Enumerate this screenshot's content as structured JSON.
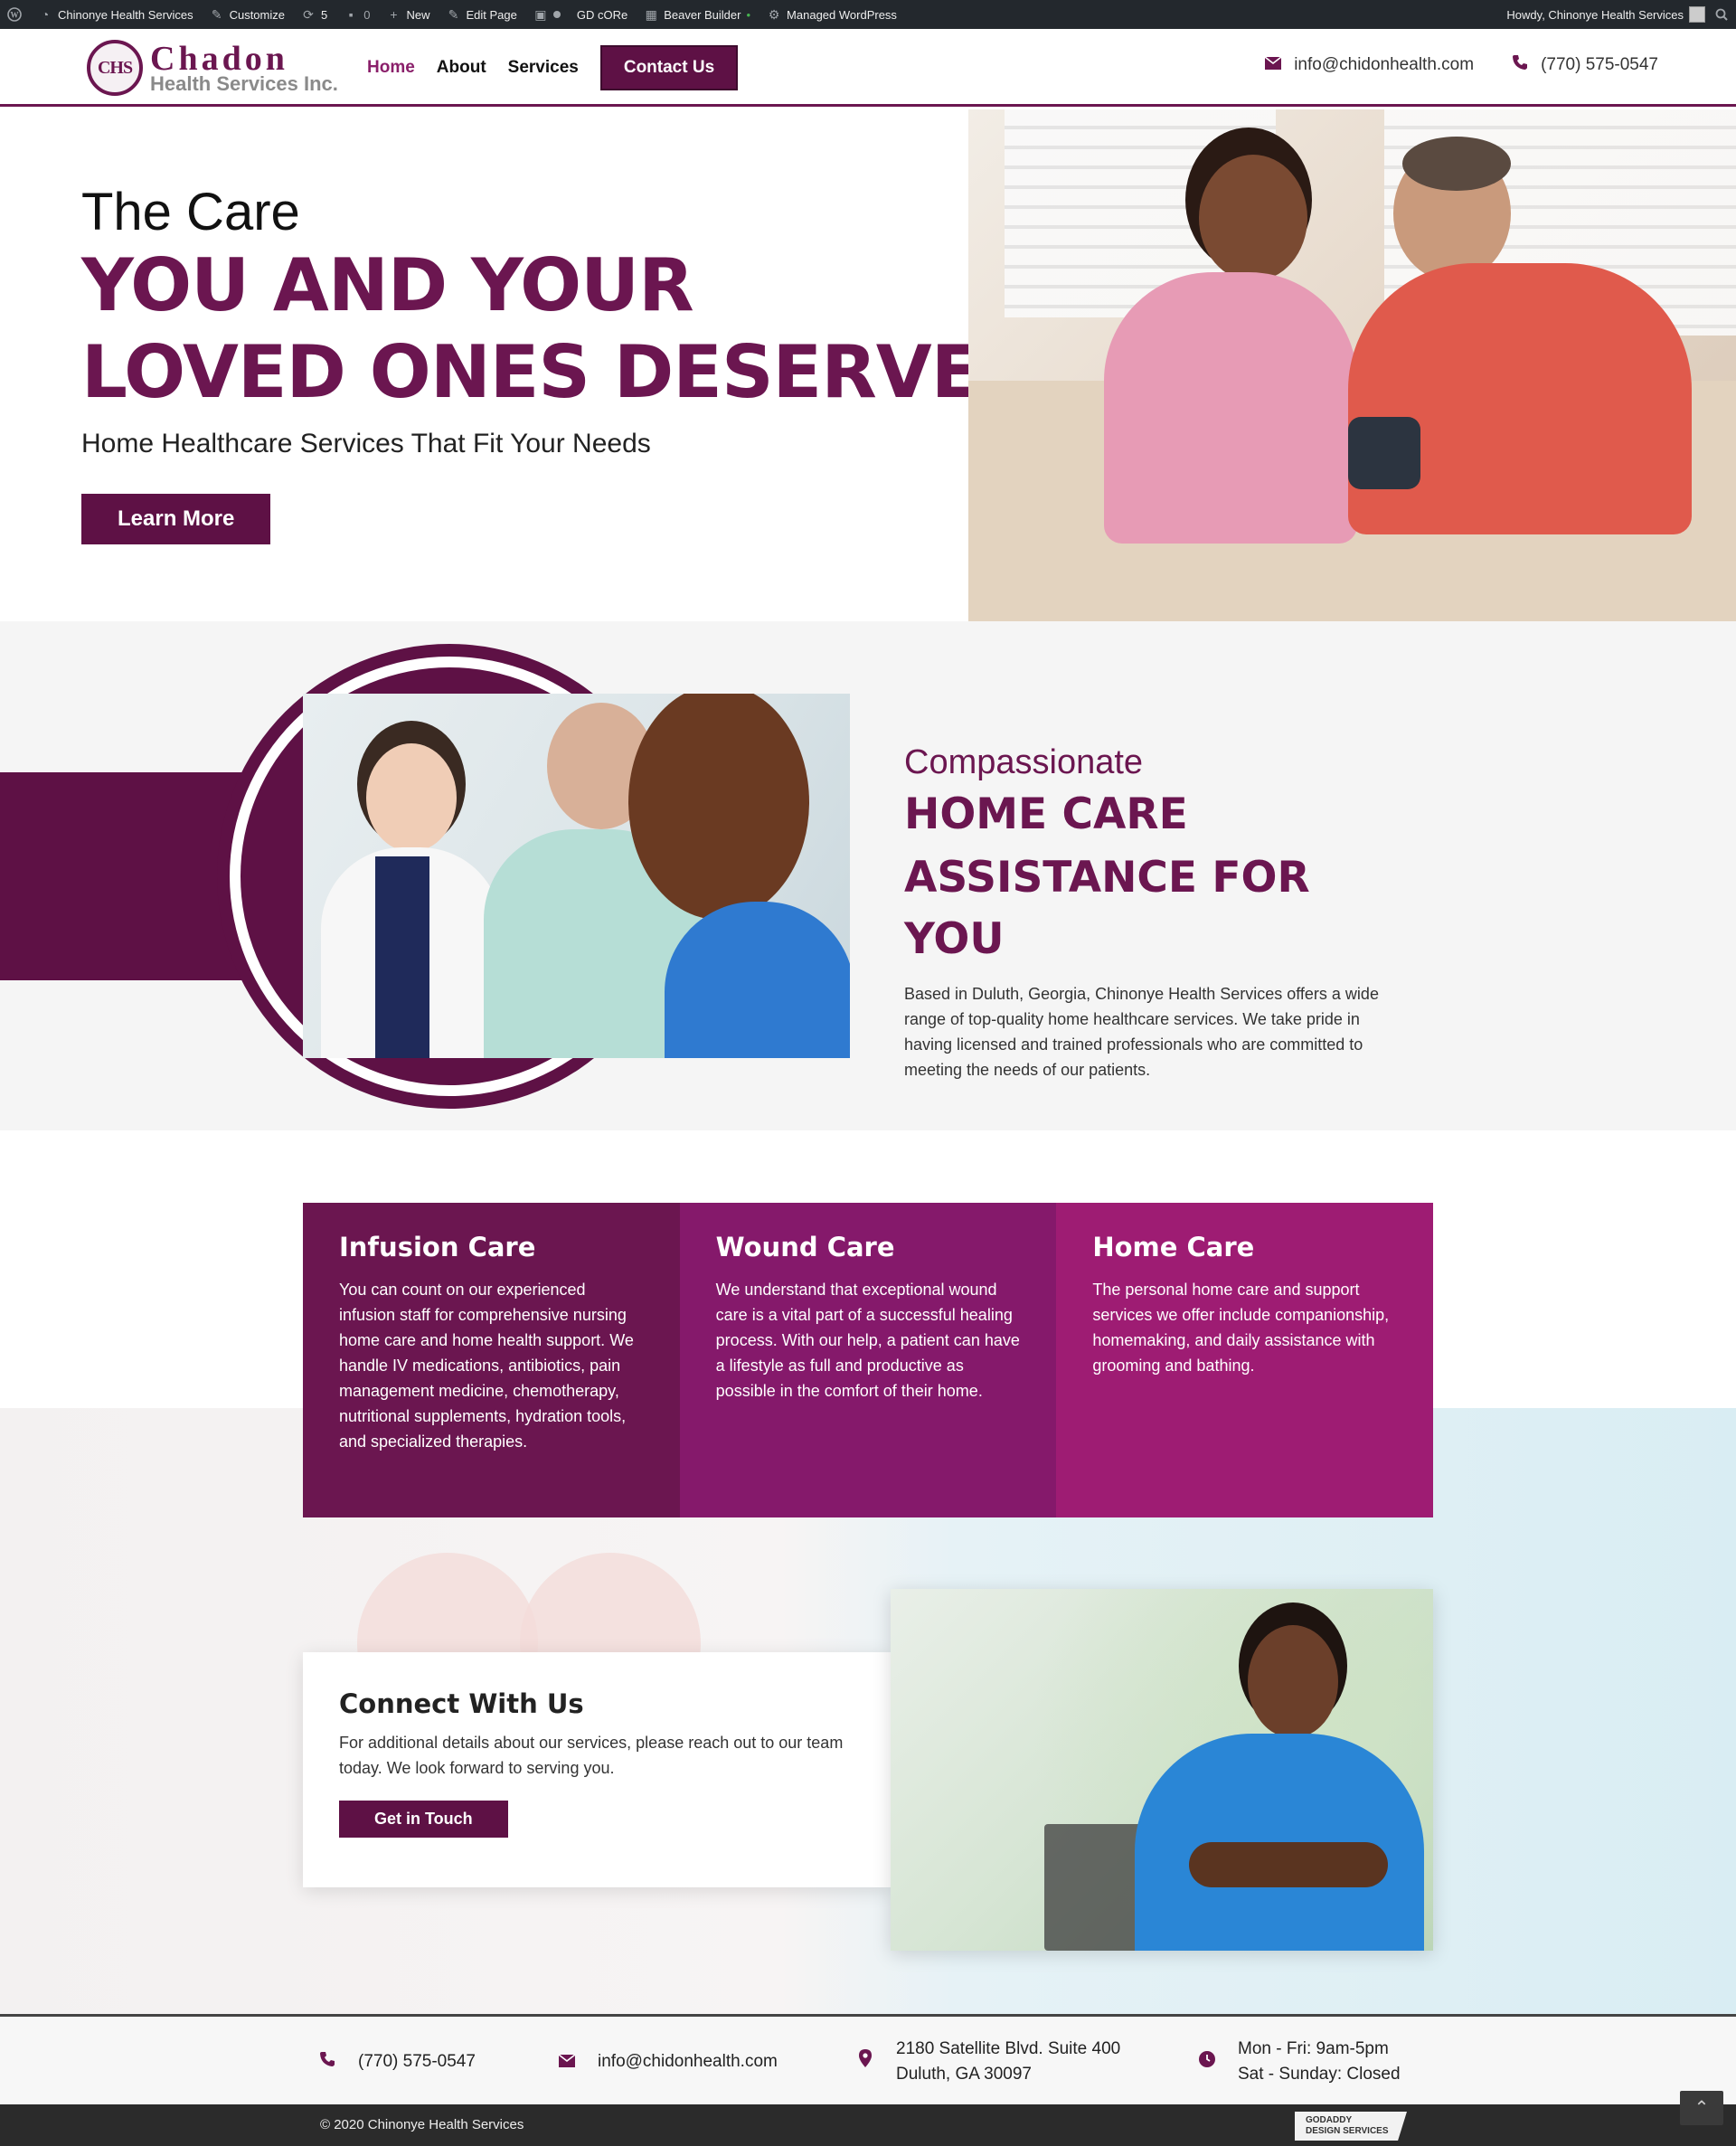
{
  "admin_bar": {
    "site_name": "Chinonye Health Services",
    "customize": "Customize",
    "updates_count": "5",
    "comments_count": "0",
    "new": "New",
    "edit_page": "Edit Page",
    "gd_core": "GD cORe",
    "beaver_builder": "Beaver Builder",
    "managed_wp": "Managed WordPress",
    "howdy": "Howdy, Chinonye Health Services"
  },
  "header": {
    "logo_mark": "CHS",
    "logo_name": "Chadon",
    "logo_sub": "Health Services Inc.",
    "nav": {
      "home": "Home",
      "about": "About",
      "services": "Services",
      "contact": "Contact Us"
    },
    "email": "info@chidonhealth.com",
    "phone": "(770) 575-0547"
  },
  "hero": {
    "small": "The Care",
    "big_line1": "YOU AND YOUR",
    "big_line2": "LOVED ONES DESERVE",
    "subtitle": "Home Healthcare Services That Fit Your Needs",
    "button": "Learn More"
  },
  "about": {
    "small": "Compassionate",
    "big_line1": "HOME CARE",
    "big_line2": "ASSISTANCE FOR YOU",
    "body": "Based in Duluth, Georgia, Chinonye Health Services offers a wide range of top-quality home healthcare services. We take pride in having licensed and trained professionals who are committed to meeting the needs of our patients."
  },
  "services": [
    {
      "title": "Infusion Care",
      "body": "You can count on our experienced infusion staff for comprehensive nursing home care and home health support. We handle IV medications, antibiotics, pain management medicine, chemotherapy, nutritional supplements, hydration tools, and specialized therapies."
    },
    {
      "title": "Wound Care",
      "body": "We understand that exceptional wound care is a vital part of a successful healing process. With our help, a patient can have a lifestyle as full and productive as possible in the comfort of their home."
    },
    {
      "title": "Home Care",
      "body": "The personal home care and support services we offer include companionship, homemaking, and daily assistance with grooming and bathing."
    }
  ],
  "connect": {
    "title": "Connect With Us",
    "body": "For additional details about our services, please reach out to our team today. We look forward to serving you.",
    "button": "Get in Touch"
  },
  "footer": {
    "phone": "(770) 575-0547",
    "email": "info@chidonhealth.com",
    "address_line1": "2180 Satellite Blvd. Suite 400",
    "address_line2": "Duluth, GA 30097",
    "hours_line1": "Mon - Fri: 9am-5pm",
    "hours_line2": "Sat - Sunday: Closed",
    "copyright": "© 2020 Chinonye Health Services",
    "badge_line1": "GODADDY",
    "badge_line2": "DESIGN SERVICES"
  },
  "icons": {
    "email": "envelope-icon",
    "phone": "phone-icon",
    "location": "map-pin-icon",
    "hours": "clock-icon"
  },
  "colors": {
    "brand": "#6b1650",
    "button": "#5e1145",
    "card2": "#85196b",
    "card3": "#9e1c73"
  }
}
